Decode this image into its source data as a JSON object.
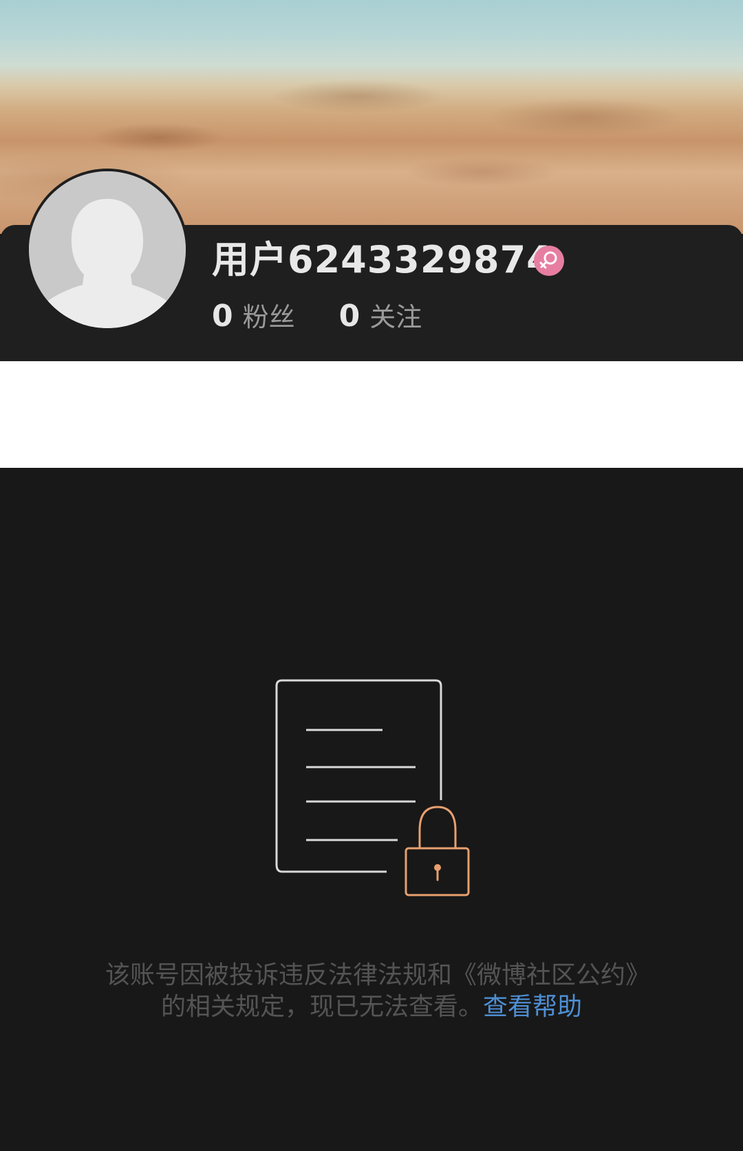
{
  "profile": {
    "username": "用户6243329874",
    "gender_icon": "female-icon",
    "gender_color": "#e77ea2",
    "stats": [
      {
        "count": "0",
        "label": "粉丝"
      },
      {
        "count": "0",
        "label": "关注"
      }
    ]
  },
  "blocked": {
    "icon": "locked-document-icon",
    "lock_color": "#e8a06e",
    "message": "该账号因被投诉违反法律法规和《微博社区公约》的相关规定，现已无法查看。",
    "help_link": "查看帮助",
    "help_link_color": "#4e8fd4"
  }
}
